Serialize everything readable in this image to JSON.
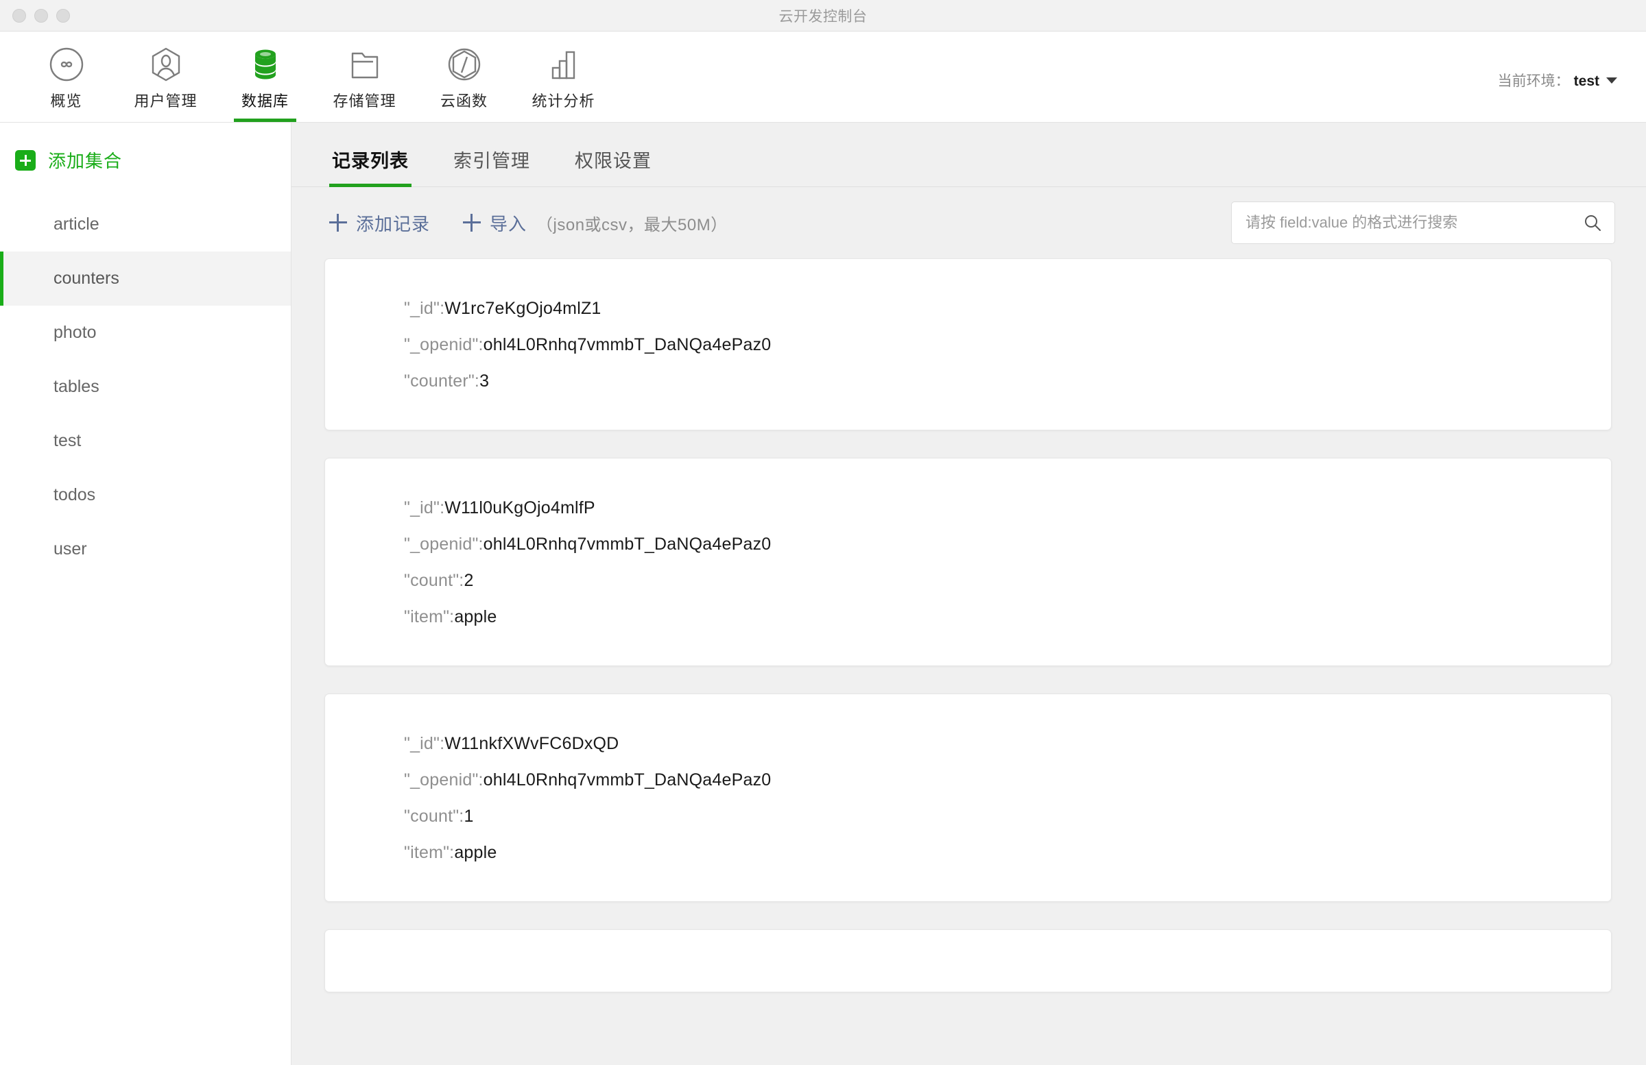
{
  "window": {
    "title": "云开发控制台",
    "traffic_lights": [
      "close",
      "minimize",
      "maximize"
    ]
  },
  "topnav": {
    "items": [
      {
        "label": "概览",
        "icon": "infinity-circle-icon",
        "active": false
      },
      {
        "label": "用户管理",
        "icon": "user-hexagon-icon",
        "active": false
      },
      {
        "label": "数据库",
        "icon": "database-icon",
        "active": true
      },
      {
        "label": "存储管理",
        "icon": "folder-icon",
        "active": false
      },
      {
        "label": "云函数",
        "icon": "cloud-function-icon",
        "active": false
      },
      {
        "label": "统计分析",
        "icon": "bar-chart-icon",
        "active": false
      }
    ],
    "env_label": "当前环境：",
    "env_value": "test",
    "env_caret_icon": "chevron-down-icon"
  },
  "sidebar": {
    "add_collection_label": "添加集合",
    "add_icon": "plus-square-icon",
    "collections": [
      {
        "name": "article",
        "selected": false
      },
      {
        "name": "counters",
        "selected": true
      },
      {
        "name": "photo",
        "selected": false
      },
      {
        "name": "tables",
        "selected": false
      },
      {
        "name": "test",
        "selected": false
      },
      {
        "name": "todos",
        "selected": false
      },
      {
        "name": "user",
        "selected": false
      }
    ]
  },
  "main": {
    "tabs": [
      {
        "label": "记录列表",
        "active": true
      },
      {
        "label": "索引管理",
        "active": false
      },
      {
        "label": "权限设置",
        "active": false
      }
    ],
    "toolbar": {
      "add_record_label": "添加记录",
      "import_label": "导入",
      "import_hint": "（json或csv，最大50M）",
      "plus_icon": "plus-icon"
    },
    "search": {
      "placeholder": "请按 field:value 的格式进行搜索",
      "value": "",
      "icon": "search-icon"
    },
    "records": [
      {
        "fields": [
          {
            "key": "\"_id\":",
            "value": "W1rc7eKgOjo4mlZ1"
          },
          {
            "key": "\"_openid\":",
            "value": "ohl4L0Rnhq7vmmbT_DaNQa4ePaz0"
          },
          {
            "key": "\"counter\":",
            "value": "3"
          }
        ]
      },
      {
        "fields": [
          {
            "key": "\"_id\":",
            "value": "W11l0uKgOjo4mlfP"
          },
          {
            "key": "\"_openid\":",
            "value": "ohl4L0Rnhq7vmmbT_DaNQa4ePaz0"
          },
          {
            "key": "\"count\":",
            "value": "2"
          },
          {
            "key": "\"item\":",
            "value": "apple"
          }
        ]
      },
      {
        "fields": [
          {
            "key": "\"_id\":",
            "value": "W11nkfXWvFC6DxQD"
          },
          {
            "key": "\"_openid\":",
            "value": "ohl4L0Rnhq7vmmbT_DaNQa4ePaz0"
          },
          {
            "key": "\"count\":",
            "value": "1"
          },
          {
            "key": "\"item\":",
            "value": "apple"
          }
        ]
      },
      {
        "fields": []
      }
    ]
  },
  "colors": {
    "brand_green": "#1aad19",
    "tab_underline_green": "#22a11e",
    "link_blue": "#5b6f99",
    "content_bg": "#f0f0f0",
    "titlebar_bg": "#f2f2f2",
    "key_gray": "#8f8f8f",
    "value_black": "#1a1a1a"
  }
}
